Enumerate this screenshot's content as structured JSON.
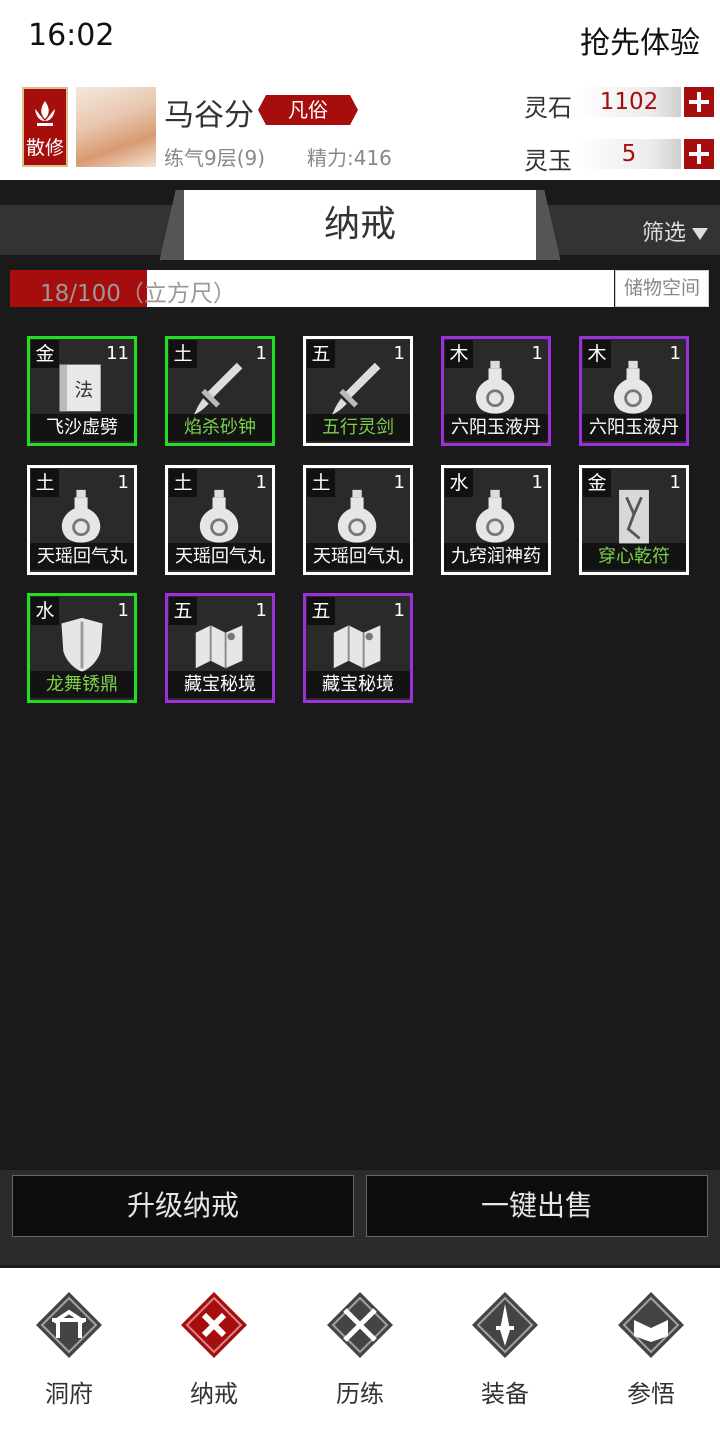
{
  "status": {
    "time": "16:02"
  },
  "header": {
    "try_label": "抢先体验"
  },
  "player": {
    "sect": "散修",
    "name": "马谷分",
    "rank": "凡俗",
    "level": "练气9层(9)",
    "energy": "精力:416"
  },
  "resources": [
    {
      "label": "灵石",
      "value": "1102"
    },
    {
      "label": "灵玉",
      "value": "5"
    }
  ],
  "bag": {
    "title": "纳戒",
    "filter_label": "筛选",
    "capacity_text": "18/100（立方尺）",
    "capacity_used": 18,
    "capacity_total": 100,
    "storage_label": "储物空间"
  },
  "items": [
    {
      "element": "金",
      "count": "11",
      "name": "飞沙虚劈",
      "name_color": "#ffffff",
      "border": "#22dd22",
      "icon": "manual-icon"
    },
    {
      "element": "土",
      "count": "1",
      "name": "焰杀砂钟",
      "name_color": "#7cd04a",
      "border": "#22dd22",
      "icon": "sword-icon"
    },
    {
      "element": "五",
      "count": "1",
      "name": "五行灵剑",
      "name_color": "#7cd04a",
      "border": "#ffffff",
      "icon": "sword-icon"
    },
    {
      "element": "木",
      "count": "1",
      "name": "六阳玉液丹",
      "name_color": "#ffffff",
      "border": "#9b30d9",
      "icon": "gourd-icon"
    },
    {
      "element": "木",
      "count": "1",
      "name": "六阳玉液丹",
      "name_color": "#ffffff",
      "border": "#9b30d9",
      "icon": "gourd-icon"
    },
    {
      "element": "土",
      "count": "1",
      "name": "天瑶回气丸",
      "name_color": "#ffffff",
      "border": "#ffffff",
      "icon": "gourd-icon"
    },
    {
      "element": "土",
      "count": "1",
      "name": "天瑶回气丸",
      "name_color": "#ffffff",
      "border": "#ffffff",
      "icon": "gourd-icon"
    },
    {
      "element": "土",
      "count": "1",
      "name": "天瑶回气丸",
      "name_color": "#ffffff",
      "border": "#ffffff",
      "icon": "gourd-icon"
    },
    {
      "element": "水",
      "count": "1",
      "name": "九窍润神药",
      "name_color": "#ffffff",
      "border": "#ffffff",
      "icon": "gourd-icon"
    },
    {
      "element": "金",
      "count": "1",
      "name": "穿心乾符",
      "name_color": "#7cd04a",
      "border": "#ffffff",
      "icon": "talisman-icon"
    },
    {
      "element": "水",
      "count": "1",
      "name": "龙舞锈鼎",
      "name_color": "#7cd04a",
      "border": "#22dd22",
      "icon": "shield-icon"
    },
    {
      "element": "五",
      "count": "1",
      "name": "藏宝秘境",
      "name_color": "#ffffff",
      "border": "#9b30d9",
      "icon": "map-icon"
    },
    {
      "element": "五",
      "count": "1",
      "name": "藏宝秘境",
      "name_color": "#ffffff",
      "border": "#9b30d9",
      "icon": "map-icon"
    }
  ],
  "actions": {
    "upgrade_label": "升级纳戒",
    "sell_label": "一键出售"
  },
  "nav": [
    {
      "label": "洞府",
      "icon": "cave-icon",
      "active": false
    },
    {
      "label": "纳戒",
      "icon": "ring-icon",
      "active": true
    },
    {
      "label": "历练",
      "icon": "swords-icon",
      "active": false
    },
    {
      "label": "装备",
      "icon": "dagger-icon",
      "active": false
    },
    {
      "label": "参悟",
      "icon": "book-icon",
      "active": false
    }
  ],
  "colors": {
    "accent_red": "#a60e0e",
    "green_quality": "#22dd22",
    "purple_quality": "#9b30d9"
  }
}
